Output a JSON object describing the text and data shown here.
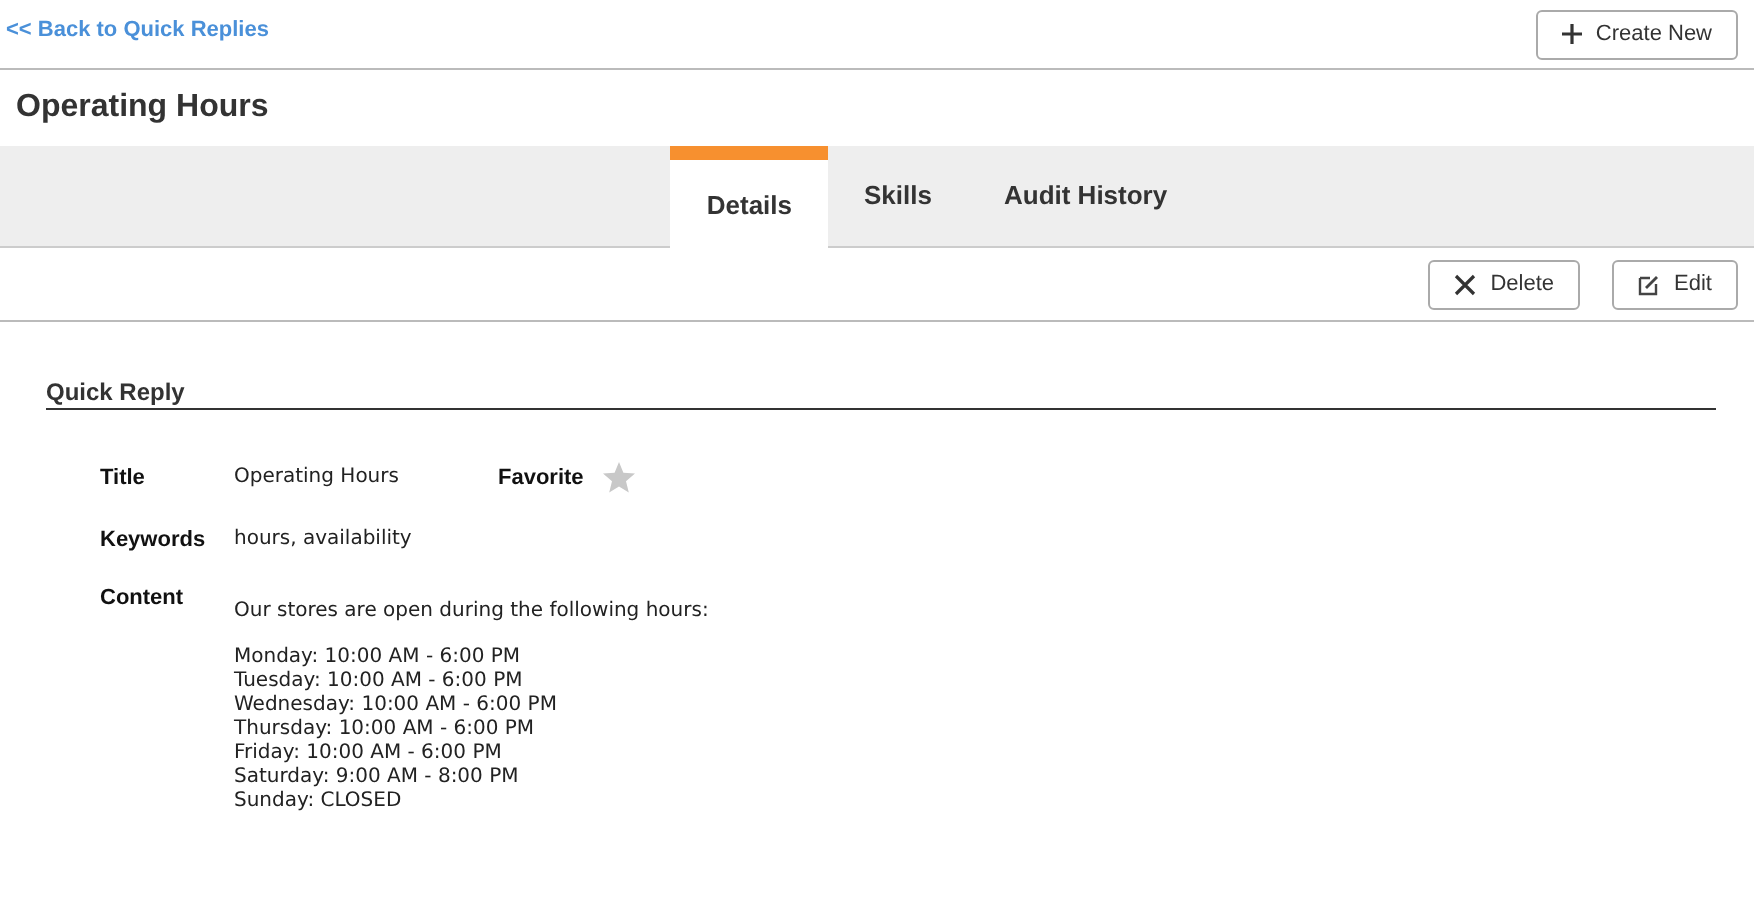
{
  "back_link": "<< Back to Quick Replies",
  "create_button": "Create New",
  "page_title": "Operating Hours",
  "tabs": [
    {
      "label": "Details",
      "selected": true
    },
    {
      "label": "Skills",
      "selected": false
    },
    {
      "label": "Audit History",
      "selected": false
    }
  ],
  "actions": [
    {
      "kind": "delete",
      "label": "Delete"
    },
    {
      "kind": "edit",
      "label": "Edit"
    }
  ],
  "section_title": "Quick Reply",
  "fields": {
    "title_label": "Title",
    "title_value": "Operating Hours",
    "favorite_label": "Favorite",
    "favorite": false,
    "keywords_label": "Keywords",
    "keywords_value": "hours, availability",
    "content_label": "Content",
    "content_intro": "Our stores are open during the following hours:",
    "content_lines": [
      "Monday: 10:00 AM - 6:00 PM",
      "Tuesday: 10:00 AM - 6:00 PM",
      "Wednesday: 10:00 AM - 6:00 PM",
      "Thursday: 10:00 AM - 6:00 PM",
      "Friday: 10:00 AM - 6:00 PM",
      "Saturday: 9:00 AM - 8:00 PM",
      "Sunday: CLOSED"
    ]
  }
}
